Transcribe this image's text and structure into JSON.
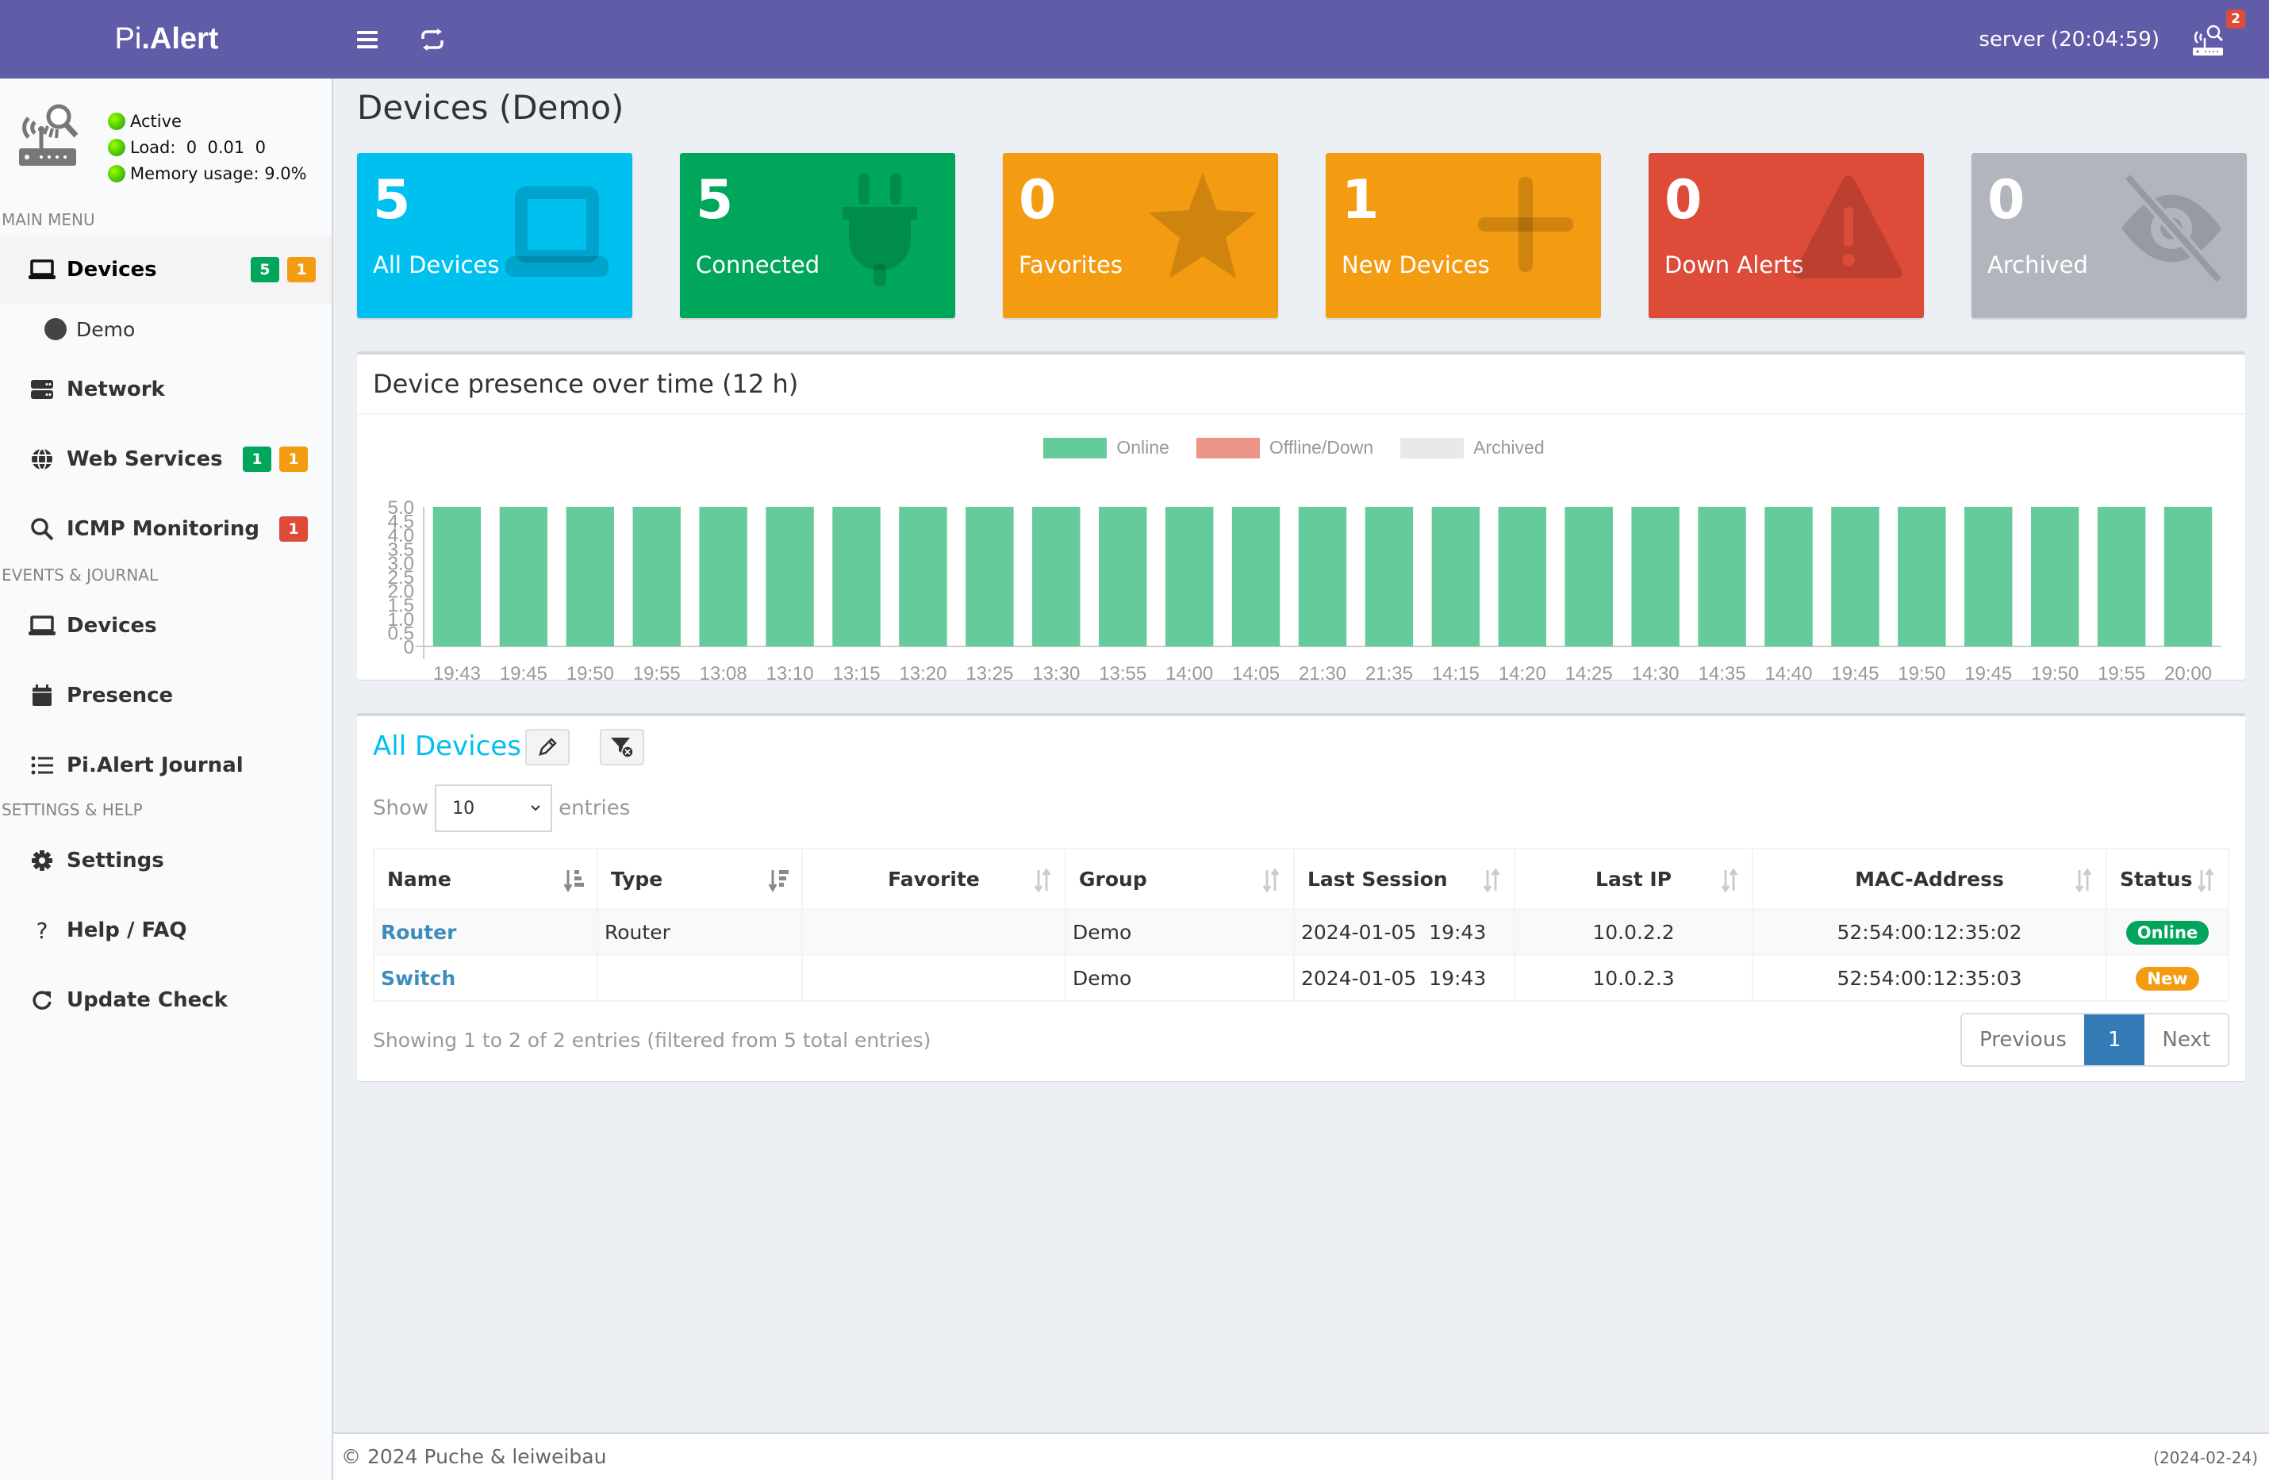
{
  "app": {
    "logo_prefix": "Pi",
    "logo_suffix": ".Alert",
    "server_time": "server (20:04:59)",
    "alert_count": "2"
  },
  "sidebar": {
    "status": {
      "active": "Active",
      "load": "Load:  0  0.01  0",
      "memory": "Memory usage:  9.0%"
    },
    "sections": {
      "main": "MAIN MENU",
      "events": "EVENTS & JOURNAL",
      "settings": "SETTINGS & HELP"
    },
    "main_items": [
      {
        "label": "Devices",
        "icon": "laptop-icon",
        "badges": [
          {
            "value": "5",
            "color": "#00a65a"
          },
          {
            "value": "1",
            "color": "#f39c12"
          }
        ],
        "active": true
      },
      {
        "label": "Demo",
        "icon": "circle-icon",
        "sub": true
      },
      {
        "label": "Network",
        "icon": "server-icon"
      },
      {
        "label": "Web Services",
        "icon": "globe-icon",
        "badges": [
          {
            "value": "1",
            "color": "#00a65a"
          },
          {
            "value": "1",
            "color": "#f39c12"
          }
        ]
      },
      {
        "label": "ICMP Monitoring",
        "icon": "search-icon",
        "badges": [
          {
            "value": "1",
            "color": "#dd4b39"
          }
        ]
      }
    ],
    "events_items": [
      {
        "label": "Devices",
        "icon": "laptop-icon"
      },
      {
        "label": "Presence",
        "icon": "calendar-icon"
      },
      {
        "label": "Pi.Alert Journal",
        "icon": "list-icon"
      }
    ],
    "settings_items": [
      {
        "label": "Settings",
        "icon": "gear-icon"
      },
      {
        "label": "Help / FAQ",
        "icon": "question-icon"
      },
      {
        "label": "Update Check",
        "icon": "refresh-icon"
      }
    ]
  },
  "page": {
    "title": "Devices (Demo)"
  },
  "stat_boxes": [
    {
      "value": "5",
      "label": "All Devices",
      "color": "#00c0ef",
      "icon": "laptop-icon"
    },
    {
      "value": "5",
      "label": "Connected",
      "color": "#00a65a",
      "icon": "plug-icon"
    },
    {
      "value": "0",
      "label": "Favorites",
      "color": "#f39c12",
      "icon": "star-icon"
    },
    {
      "value": "1",
      "label": "New Devices",
      "color": "#f39c12",
      "icon": "plus-icon"
    },
    {
      "value": "0",
      "label": "Down Alerts",
      "color": "#dd4b39",
      "icon": "warning-icon"
    },
    {
      "value": "0",
      "label": "Archived",
      "color": "#b2b5bd",
      "icon": "eye-slash-icon"
    }
  ],
  "chart_data": {
    "type": "bar",
    "title": "Device presence over time (12 h)",
    "xlabel": "",
    "ylabel": "",
    "ylim": [
      0,
      5
    ],
    "yticks": [
      "0",
      "0.5",
      "1.0",
      "1.5",
      "2.0",
      "2.5",
      "3.0",
      "3.5",
      "4.0",
      "4.5",
      "5.0"
    ],
    "legend_position": "top",
    "categories": [
      "19:43",
      "19:45",
      "19:50",
      "19:55",
      "13:08",
      "13:10",
      "13:15",
      "13:20",
      "13:25",
      "13:30",
      "13:55",
      "14:00",
      "14:05",
      "21:30",
      "21:35",
      "14:15",
      "14:20",
      "14:25",
      "14:30",
      "14:35",
      "14:40",
      "19:45",
      "19:50",
      "19:45",
      "19:50",
      "19:55",
      "20:00"
    ],
    "series": [
      {
        "name": "Online",
        "color": "#66cb9a",
        "values": [
          5,
          5,
          5,
          5,
          5,
          5,
          5,
          5,
          5,
          5,
          5,
          5,
          5,
          5,
          5,
          5,
          5,
          5,
          5,
          5,
          5,
          5,
          5,
          5,
          5,
          5,
          5
        ]
      },
      {
        "name": "Offline/Down",
        "color": "#ec9487",
        "values": [
          0,
          0,
          0,
          0,
          0,
          0,
          0,
          0,
          0,
          0,
          0,
          0,
          0,
          0,
          0,
          0,
          0,
          0,
          0,
          0,
          0,
          0,
          0,
          0,
          0,
          0,
          0
        ]
      },
      {
        "name": "Archived",
        "color": "#e8e8e8",
        "values": [
          0,
          0,
          0,
          0,
          0,
          0,
          0,
          0,
          0,
          0,
          0,
          0,
          0,
          0,
          0,
          0,
          0,
          0,
          0,
          0,
          0,
          0,
          0,
          0,
          0,
          0,
          0
        ]
      }
    ]
  },
  "devices_table": {
    "title": "All Devices",
    "show_label": "Show",
    "entries_label": "entries",
    "page_size": "10",
    "columns": [
      "Name",
      "Type",
      "Favorite",
      "Group",
      "Last Session",
      "Last IP",
      "MAC-Address",
      "Status"
    ],
    "rows": [
      {
        "name": "Router",
        "type": "Router",
        "favorite": "",
        "group": "Demo",
        "last_session": "2024-01-05  19:43",
        "last_ip": "10.0.2.2",
        "mac": "52:54:00:12:35:02",
        "status": "Online",
        "status_color": "#00a65a"
      },
      {
        "name": "Switch",
        "type": "",
        "favorite": "",
        "group": "Demo",
        "last_session": "2024-01-05  19:43",
        "last_ip": "10.0.2.3",
        "mac": "52:54:00:12:35:03",
        "status": "New",
        "status_color": "#f39c12"
      }
    ],
    "info": "Showing 1 to 2 of 2 entries (filtered from 5 total entries)",
    "pagination": {
      "previous": "Previous",
      "current": "1",
      "next": "Next"
    }
  },
  "footer": {
    "copyright": "© 2024 Puche & leiweibau",
    "version": "(2024-02-24)"
  }
}
